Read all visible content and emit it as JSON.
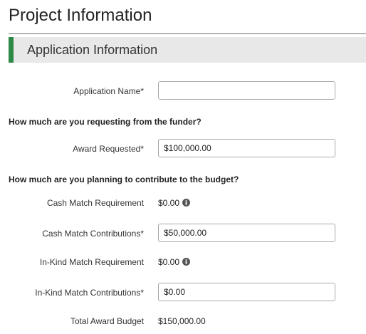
{
  "page": {
    "title": "Project Information"
  },
  "section": {
    "title": "Application Information"
  },
  "form": {
    "application_name": {
      "label": "Application Name*",
      "value": ""
    },
    "question_request": "How much are you requesting from the funder?",
    "award_requested": {
      "label": "Award Requested*",
      "value": "$100,000.00"
    },
    "question_contribute": "How much are you planning to contribute to the budget?",
    "cash_match_requirement": {
      "label": "Cash Match Requirement",
      "value": "$0.00"
    },
    "cash_match_contributions": {
      "label": "Cash Match Contributions*",
      "value": "$50,000.00"
    },
    "inkind_match_requirement": {
      "label": "In-Kind Match Requirement",
      "value": "$0.00"
    },
    "inkind_match_contributions": {
      "label": "In-Kind Match Contributions*",
      "value": "$0.00"
    },
    "total_award_budget": {
      "label": "Total Award Budget",
      "value": "$150,000.00"
    }
  },
  "icons": {
    "info": "info-circle-icon"
  },
  "colors": {
    "section_accent": "#2f8a47",
    "section_background": "#e8e8e8"
  }
}
